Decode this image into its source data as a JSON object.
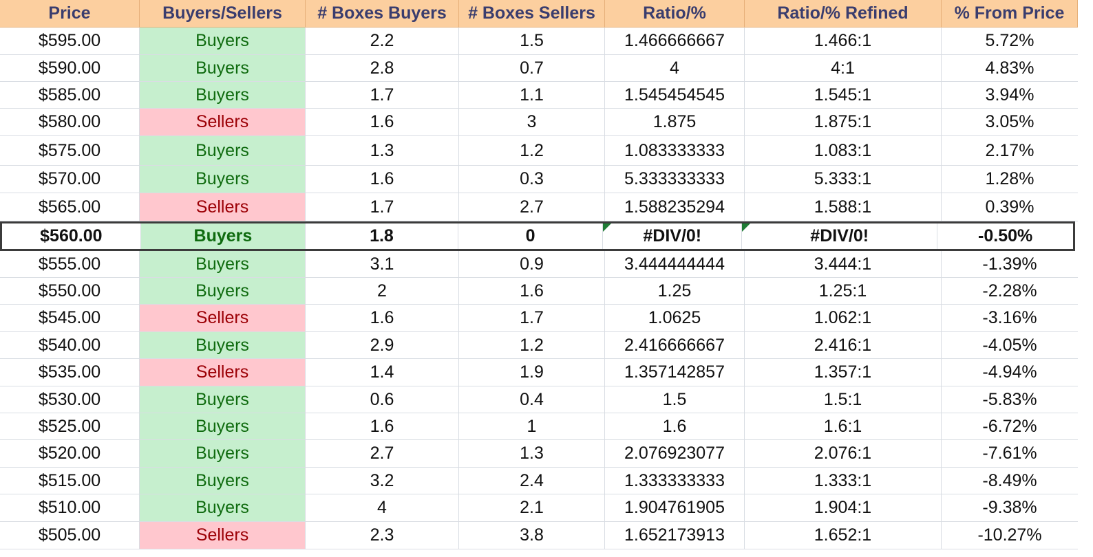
{
  "columns": [
    "Price",
    "Buyers/Sellers",
    "# Boxes Buyers",
    "# Boxes Sellers",
    "Ratio/%",
    "Ratio/% Refined",
    "% From Price"
  ],
  "rows": [
    {
      "price": "$595.00",
      "side": "Buyers",
      "boxes_buyers": "2.2",
      "boxes_sellers": "1.5",
      "ratio": "1.466666667",
      "ratio_refined": "1.466:1",
      "pct_from_price": "5.72%"
    },
    {
      "price": "$590.00",
      "side": "Buyers",
      "boxes_buyers": "2.8",
      "boxes_sellers": "0.7",
      "ratio": "4",
      "ratio_refined": "4:1",
      "pct_from_price": "4.83%"
    },
    {
      "price": "$585.00",
      "side": "Buyers",
      "boxes_buyers": "1.7",
      "boxes_sellers": "1.1",
      "ratio": "1.545454545",
      "ratio_refined": "1.545:1",
      "pct_from_price": "3.94%"
    },
    {
      "price": "$580.00",
      "side": "Sellers",
      "boxes_buyers": "1.6",
      "boxes_sellers": "3",
      "ratio": "1.875",
      "ratio_refined": "1.875:1",
      "pct_from_price": "3.05%"
    },
    {
      "price": "$575.00",
      "side": "Buyers",
      "boxes_buyers": "1.3",
      "boxes_sellers": "1.2",
      "ratio": "1.083333333",
      "ratio_refined": "1.083:1",
      "pct_from_price": "2.17%"
    },
    {
      "price": "$570.00",
      "side": "Buyers",
      "boxes_buyers": "1.6",
      "boxes_sellers": "0.3",
      "ratio": "5.333333333",
      "ratio_refined": "5.333:1",
      "pct_from_price": "1.28%"
    },
    {
      "price": "$565.00",
      "side": "Sellers",
      "boxes_buyers": "1.7",
      "boxes_sellers": "2.7",
      "ratio": "1.588235294",
      "ratio_refined": "1.588:1",
      "pct_from_price": "0.39%"
    },
    {
      "price": "$560.00",
      "side": "Buyers",
      "boxes_buyers": "1.8",
      "boxes_sellers": "0",
      "ratio": "#DIV/0!",
      "ratio_refined": "#DIV/0!",
      "pct_from_price": "-0.50%",
      "current": true
    },
    {
      "price": "$555.00",
      "side": "Buyers",
      "boxes_buyers": "3.1",
      "boxes_sellers": "0.9",
      "ratio": "3.444444444",
      "ratio_refined": "3.444:1",
      "pct_from_price": "-1.39%"
    },
    {
      "price": "$550.00",
      "side": "Buyers",
      "boxes_buyers": "2",
      "boxes_sellers": "1.6",
      "ratio": "1.25",
      "ratio_refined": "1.25:1",
      "pct_from_price": "-2.28%"
    },
    {
      "price": "$545.00",
      "side": "Sellers",
      "boxes_buyers": "1.6",
      "boxes_sellers": "1.7",
      "ratio": "1.0625",
      "ratio_refined": "1.062:1",
      "pct_from_price": "-3.16%"
    },
    {
      "price": "$540.00",
      "side": "Buyers",
      "boxes_buyers": "2.9",
      "boxes_sellers": "1.2",
      "ratio": "2.416666667",
      "ratio_refined": "2.416:1",
      "pct_from_price": "-4.05%"
    },
    {
      "price": "$535.00",
      "side": "Sellers",
      "boxes_buyers": "1.4",
      "boxes_sellers": "1.9",
      "ratio": "1.357142857",
      "ratio_refined": "1.357:1",
      "pct_from_price": "-4.94%"
    },
    {
      "price": "$530.00",
      "side": "Buyers",
      "boxes_buyers": "0.6",
      "boxes_sellers": "0.4",
      "ratio": "1.5",
      "ratio_refined": "1.5:1",
      "pct_from_price": "-5.83%"
    },
    {
      "price": "$525.00",
      "side": "Buyers",
      "boxes_buyers": "1.6",
      "boxes_sellers": "1",
      "ratio": "1.6",
      "ratio_refined": "1.6:1",
      "pct_from_price": "-6.72%"
    },
    {
      "price": "$520.00",
      "side": "Buyers",
      "boxes_buyers": "2.7",
      "boxes_sellers": "1.3",
      "ratio": "2.076923077",
      "ratio_refined": "2.076:1",
      "pct_from_price": "-7.61%"
    },
    {
      "price": "$515.00",
      "side": "Buyers",
      "boxes_buyers": "3.2",
      "boxes_sellers": "2.4",
      "ratio": "1.333333333",
      "ratio_refined": "1.333:1",
      "pct_from_price": "-8.49%"
    },
    {
      "price": "$510.00",
      "side": "Buyers",
      "boxes_buyers": "4",
      "boxes_sellers": "2.1",
      "ratio": "1.904761905",
      "ratio_refined": "1.904:1",
      "pct_from_price": "-9.38%"
    },
    {
      "price": "$505.00",
      "side": "Sellers",
      "boxes_buyers": "2.3",
      "boxes_sellers": "3.8",
      "ratio": "1.652173913",
      "ratio_refined": "1.652:1",
      "pct_from_price": "-10.27%"
    }
  ],
  "colors": {
    "header_bg": "#fccf9f",
    "header_text": "#3a3d6e",
    "buyers_bg": "#c6efce",
    "buyers_text": "#0f6b0f",
    "sellers_bg": "#ffc7ce",
    "sellers_text": "#9c0006",
    "error_flag": "#1e7b34"
  }
}
